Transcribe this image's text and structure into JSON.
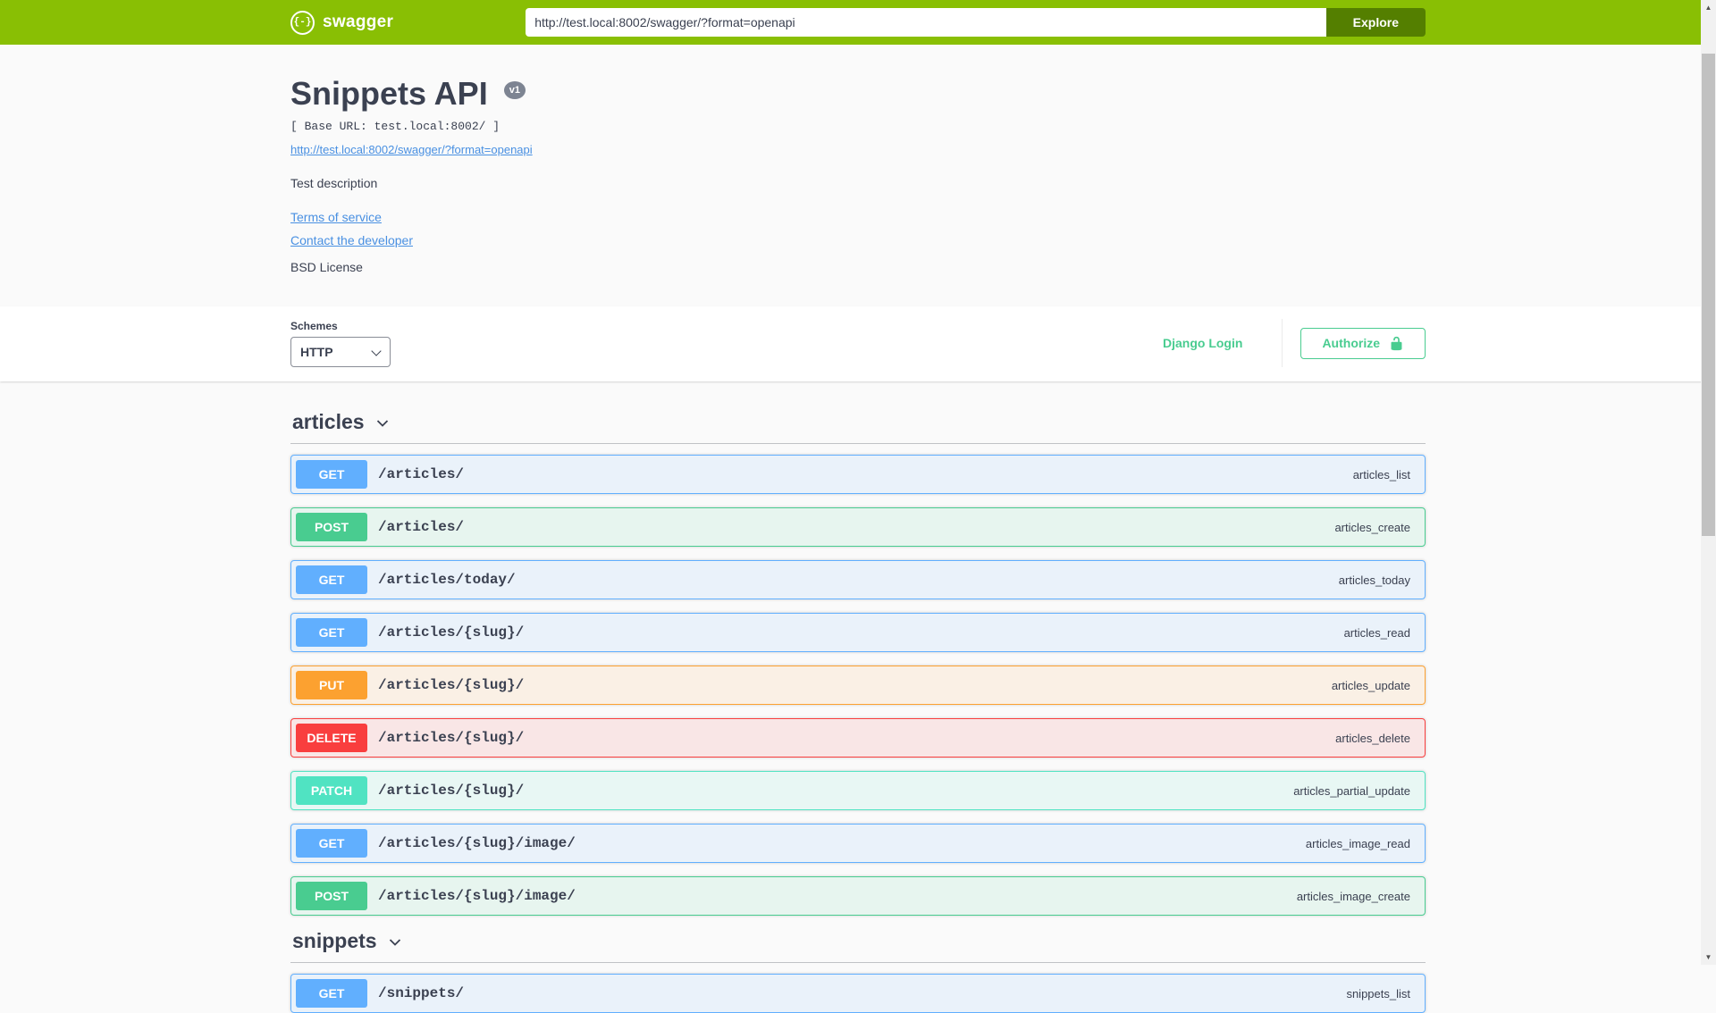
{
  "topbar": {
    "brand": "swagger",
    "url_value": "http://test.local:8002/swagger/?format=openapi",
    "explore_label": "Explore"
  },
  "info": {
    "title": "Snippets API",
    "version_badge": "v1",
    "base_url": "[ Base URL: test.local:8002/ ]",
    "spec_link": "http://test.local:8002/swagger/?format=openapi",
    "description": "Test description",
    "links": [
      {
        "label": "Terms of service"
      },
      {
        "label": "Contact the developer"
      }
    ],
    "license": "BSD License"
  },
  "schemes": {
    "label": "Schemes",
    "selected": "HTTP",
    "django_login_label": "Django Login",
    "authorize_label": "Authorize"
  },
  "colors": {
    "topbar": "#89bf04",
    "explore": "#547f00",
    "link": "#4990e2",
    "auth": "#49cc90",
    "get": "#61affe",
    "post": "#49cc90",
    "put": "#fca130",
    "delete": "#f93e3e",
    "patch": "#50e3c2"
  },
  "sections": [
    {
      "name": "articles",
      "operations": [
        {
          "method": "GET",
          "path": "/articles/",
          "operation_id": "articles_list"
        },
        {
          "method": "POST",
          "path": "/articles/",
          "operation_id": "articles_create"
        },
        {
          "method": "GET",
          "path": "/articles/today/",
          "operation_id": "articles_today"
        },
        {
          "method": "GET",
          "path": "/articles/{slug}/",
          "operation_id": "articles_read"
        },
        {
          "method": "PUT",
          "path": "/articles/{slug}/",
          "operation_id": "articles_update"
        },
        {
          "method": "DELETE",
          "path": "/articles/{slug}/",
          "operation_id": "articles_delete"
        },
        {
          "method": "PATCH",
          "path": "/articles/{slug}/",
          "operation_id": "articles_partial_update"
        },
        {
          "method": "GET",
          "path": "/articles/{slug}/image/",
          "operation_id": "articles_image_read"
        },
        {
          "method": "POST",
          "path": "/articles/{slug}/image/",
          "operation_id": "articles_image_create"
        }
      ]
    },
    {
      "name": "snippets",
      "operations": [
        {
          "method": "GET",
          "path": "/snippets/",
          "operation_id": "snippets_list"
        }
      ]
    }
  ]
}
